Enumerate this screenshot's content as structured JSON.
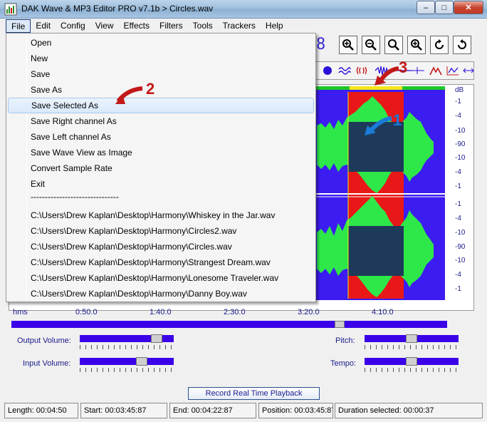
{
  "window": {
    "title": "DAK Wave & MP3 Editor PRO v7.1b > Circles.wav",
    "minimize": "–",
    "maximize": "□",
    "close": "✕"
  },
  "menubar": [
    "File",
    "Edit",
    "Config",
    "View",
    "Effects",
    "Filters",
    "Tools",
    "Trackers",
    "Help"
  ],
  "file_menu": {
    "items": [
      "Open",
      "New",
      "Save",
      "Save As",
      "Save Selected As",
      "Save Right channel As",
      "Save Left channel As",
      "Save Wave View as Image",
      "Convert Sample Rate",
      "Exit"
    ],
    "hovered": "Save Selected As",
    "separator": "-------------------------------",
    "recent_files": [
      "C:\\Users\\Drew Kaplan\\Desktop\\Harmony\\Whiskey in the Jar.wav",
      "C:\\Users\\Drew Kaplan\\Desktop\\Harmony\\Circles2.wav",
      "C:\\Users\\Drew Kaplan\\Desktop\\Harmony\\Circles.wav",
      "C:\\Users\\Drew Kaplan\\Desktop\\Harmony\\Strangest Dream.wav",
      "C:\\Users\\Drew Kaplan\\Desktop\\Harmony\\Lonesome Traveler.wav",
      "C:\\Users\\Drew Kaplan\\Desktop\\Harmony\\Danny Boy.wav"
    ]
  },
  "toolbar": {
    "zoom_buttons": [
      "zoom-in-icon",
      "zoom-out-icon",
      "zoom-fit-icon",
      "zoom-selection-icon",
      "undo-icon",
      "redo-icon"
    ],
    "effect_buttons": [
      "record-dot-icon",
      "wave-icon",
      "echo-icon",
      "waveform-icon",
      "marker-icon",
      "mountain-icon",
      "graph-icon",
      "stretch-icon"
    ],
    "digit": "8"
  },
  "waveform": {
    "db_unit": "dB",
    "db_labels_top": [
      "-1",
      "-4",
      "-10",
      "-90",
      "-10",
      "-4",
      "-1"
    ],
    "db_labels_bottom": [
      "-1",
      "-4",
      "-10",
      "-90",
      "-10",
      "-4",
      "-1"
    ],
    "colors": {
      "background": "#3c1cf0",
      "wave": "#2ee84a",
      "selection": "#e81818",
      "selection_wave": "#1e3a5a"
    },
    "time_labels": [
      "hms",
      "0:50.0",
      "1:40.0",
      "2:30.0",
      "3:20.0",
      "4:10.0"
    ],
    "position_fraction": 0.76
  },
  "controls": {
    "output_volume_label": "Output Volume:",
    "input_volume_label": "Input Volume:",
    "pitch_label": "Pitch:",
    "tempo_label": "Tempo:",
    "output_volume_level": 0.86,
    "input_volume_level": 0.68,
    "pitch_level": 0.5,
    "tempo_level": 0.5,
    "record_button": "Record Real Time Playback"
  },
  "status": {
    "length": "Length: 00:04:50",
    "start": "Start: 00:03:45:87",
    "end": "End: 00:04:22:87",
    "position": "Position: 00:03:45:87",
    "duration": "Duration selected: 00:00:37"
  },
  "annotations": [
    "1",
    "2",
    "3"
  ]
}
